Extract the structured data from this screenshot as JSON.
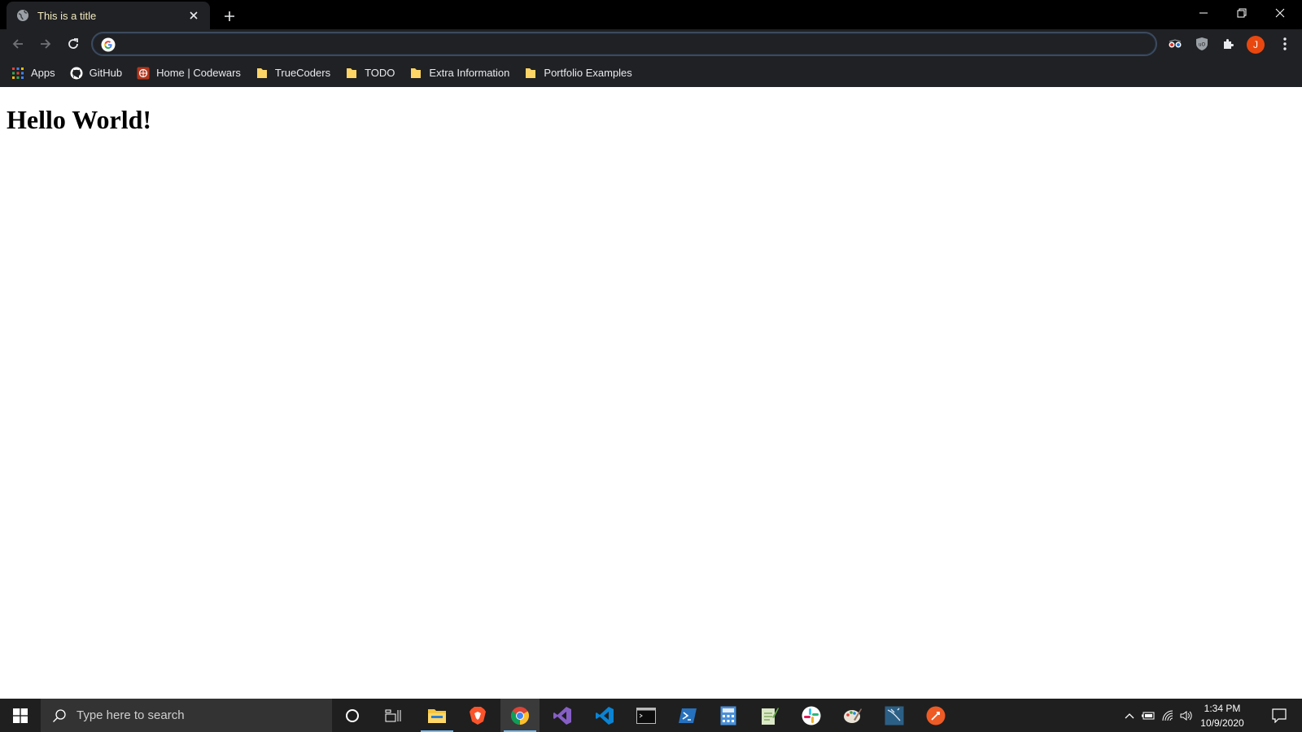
{
  "browser": {
    "tab": {
      "title": "This is a title",
      "favicon": "globe-icon"
    },
    "omnibox": {
      "value": "",
      "placeholder": ""
    },
    "profile_initial": "J",
    "colors": {
      "frame": "#000000",
      "toolbar": "#202124",
      "tab_text": "#f1ebc0",
      "profile": "#e8470f"
    }
  },
  "bookmarks": [
    {
      "label": "Apps",
      "icon": "apps-grid-icon"
    },
    {
      "label": "GitHub",
      "icon": "github-icon"
    },
    {
      "label": "Home | Codewars",
      "icon": "codewars-icon"
    },
    {
      "label": "TrueCoders",
      "icon": "folder-icon"
    },
    {
      "label": "TODO",
      "icon": "folder-icon"
    },
    {
      "label": "Extra Information",
      "icon": "folder-icon"
    },
    {
      "label": "Portfolio Examples",
      "icon": "folder-icon"
    }
  ],
  "page": {
    "heading": "Hello World!"
  },
  "taskbar": {
    "search_placeholder": "Type here to search",
    "apps": [
      "file-explorer-icon",
      "brave-icon",
      "chrome-icon",
      "visual-studio-icon",
      "vscode-icon",
      "terminal-icon",
      "powershell-icon",
      "calculator-icon",
      "notepad-icon",
      "slack-icon",
      "paint-icon",
      "workbench-icon",
      "postman-icon"
    ],
    "clock": {
      "time": "1:34 PM",
      "date": "10/9/2020"
    }
  }
}
